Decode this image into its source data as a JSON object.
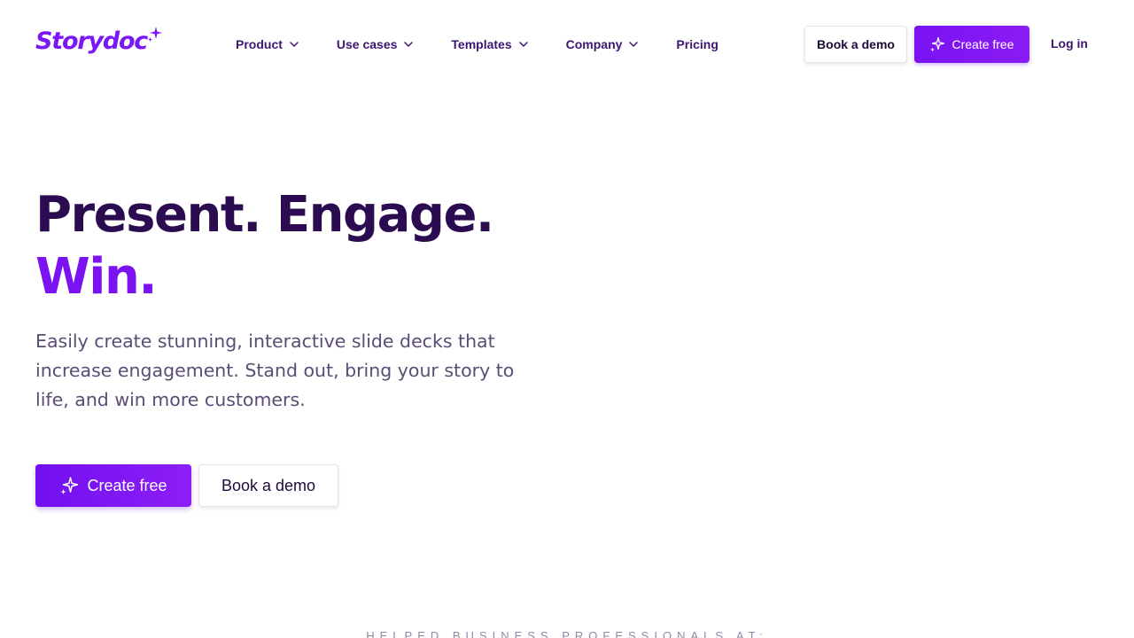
{
  "brand": {
    "name": "Storydoc",
    "logo_icon": "sparkle-icon",
    "accent_color": "#7a12f2",
    "heading_color": "#2c0c50"
  },
  "nav": {
    "items": [
      {
        "label": "Product",
        "has_dropdown": true
      },
      {
        "label": "Use cases",
        "has_dropdown": true
      },
      {
        "label": "Templates",
        "has_dropdown": true
      },
      {
        "label": "Company",
        "has_dropdown": true
      },
      {
        "label": "Pricing",
        "has_dropdown": false
      }
    ],
    "book_demo_label": "Book a demo",
    "create_free_label": "Create free",
    "login_label": "Log in"
  },
  "hero": {
    "title_line1": "Present. Engage.",
    "title_line2": "Win.",
    "subtitle": "Easily create stunning, interactive slide decks that increase engagement. Stand out, bring your story to life, and win more customers.",
    "primary_cta": "Create free",
    "secondary_cta": "Book a demo"
  },
  "trust": {
    "label": "HELPED BUSINESS PROFESSIONALS AT:"
  }
}
